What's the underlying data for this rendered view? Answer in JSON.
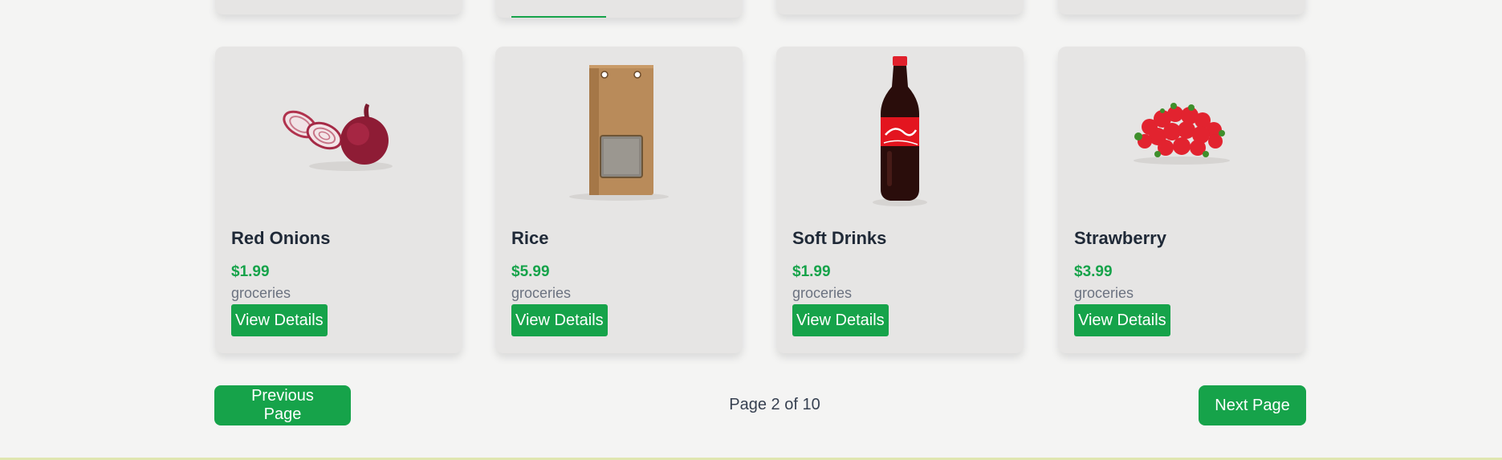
{
  "products": [
    {
      "name": "Red Onions",
      "price": "$1.99",
      "category": "groceries",
      "button": "View Details",
      "image_icon": "red-onion-icon"
    },
    {
      "name": "Rice",
      "price": "$5.99",
      "category": "groceries",
      "button": "View Details",
      "image_icon": "rice-bag-icon"
    },
    {
      "name": "Soft Drinks",
      "price": "$1.99",
      "category": "groceries",
      "button": "View Details",
      "image_icon": "soda-bottle-icon"
    },
    {
      "name": "Strawberry",
      "price": "$3.99",
      "category": "groceries",
      "button": "View Details",
      "image_icon": "strawberry-icon"
    }
  ],
  "pagination": {
    "previous_label": "Previous Page",
    "next_label": "Next Page",
    "indicator": "Page 2 of 10"
  },
  "colors": {
    "accent": "#16a34a",
    "card_background": "#e6e5e4",
    "page_background": "#f4f4f3",
    "title_text": "#1f2937",
    "muted_text": "#6b7280"
  }
}
